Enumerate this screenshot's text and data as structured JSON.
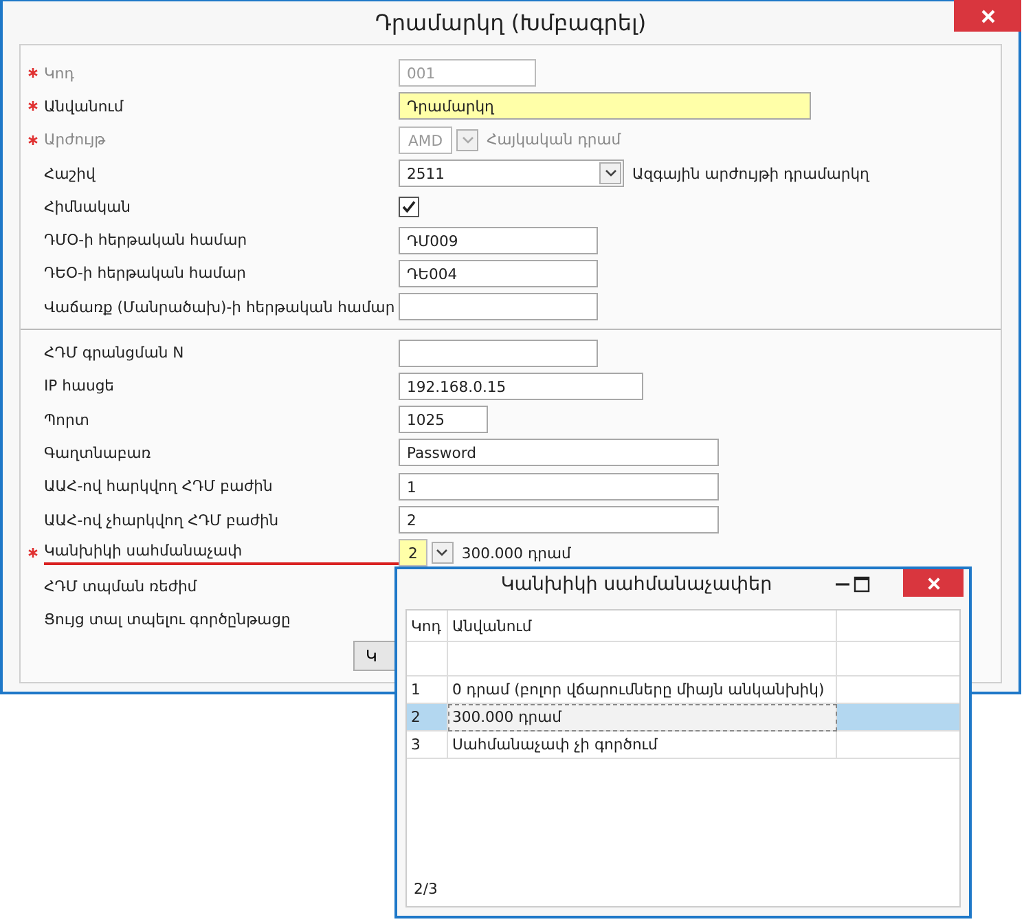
{
  "window": {
    "title": "Դրամարկղ (Խմբագրել)"
  },
  "sections": [
    {
      "fields": [
        {
          "label": "Կոդ",
          "required": true,
          "disabled": true,
          "marked": false,
          "kind": "text",
          "value": "001",
          "focused": false
        },
        {
          "label": "Անվանում",
          "required": true,
          "disabled": false,
          "marked": false,
          "kind": "text",
          "value": "Դրամարկղ",
          "focused": true
        },
        {
          "label": "Արժույթ",
          "required": true,
          "disabled": true,
          "marked": false,
          "kind": "combo",
          "value": "AMD",
          "focused": false,
          "note": "Հայկական դրամ"
        },
        {
          "label": "Հաշիվ",
          "required": false,
          "disabled": false,
          "marked": false,
          "kind": "combo",
          "value": "2511",
          "focused": false,
          "note": "Ազգային արժույթի դրամարկղ"
        },
        {
          "label": "Հիմնական",
          "required": false,
          "disabled": false,
          "marked": false,
          "kind": "checkbox",
          "checked": true
        },
        {
          "label": "ԴՄՕ-ի հերթական համար",
          "required": false,
          "disabled": false,
          "marked": false,
          "kind": "text",
          "value": "ԴՄ009",
          "focused": false
        },
        {
          "label": "ԴԵՕ-ի հերթական համար",
          "required": false,
          "disabled": false,
          "marked": false,
          "kind": "text",
          "value": "ԴԵ004",
          "focused": false
        },
        {
          "label": "Վաճառք (Մանրածախ)-ի հերթական համար",
          "required": false,
          "disabled": false,
          "marked": false,
          "kind": "text",
          "focused": false
        }
      ]
    },
    {
      "fields": [
        {
          "label": "ՀԴՄ գրանցման N",
          "required": false,
          "disabled": false,
          "marked": false,
          "kind": "text",
          "focused": false
        },
        {
          "label": "IP հասցե",
          "required": false,
          "disabled": false,
          "marked": false,
          "kind": "text",
          "value": "192.168.0.15",
          "focused": false
        },
        {
          "label": "Պորտ",
          "required": false,
          "disabled": false,
          "marked": false,
          "kind": "text",
          "value": "1025",
          "focused": false
        },
        {
          "label": "Գաղտնաբառ",
          "required": false,
          "disabled": false,
          "marked": false,
          "kind": "text",
          "value": "Password",
          "focused": false
        },
        {
          "label": "ԱԱՀ-ով հարկվող ՀԴՄ բաժին",
          "required": false,
          "disabled": false,
          "marked": false,
          "kind": "text",
          "value": "1",
          "focused": false
        },
        {
          "label": "ԱԱՀ-ով չհարկվող ՀԴՄ բաժին",
          "required": false,
          "disabled": false,
          "marked": false,
          "kind": "text",
          "value": "2",
          "focused": false
        },
        {
          "label": "Կանխիկի սահմանաչափ",
          "required": true,
          "disabled": false,
          "marked": true,
          "kind": "combo",
          "value": "2",
          "focused": true,
          "note": "300.000 դրամ"
        },
        {
          "label": "ՀԴՄ տպման ռեժիմ",
          "required": false,
          "disabled": false,
          "marked": false,
          "kind": "none"
        },
        {
          "label": "Ցույց տալ տպելու գործընթացը",
          "required": false,
          "disabled": false,
          "marked": false,
          "kind": "none"
        }
      ]
    }
  ],
  "button": "Կ",
  "popup": {
    "title": "Կանխիկի սահմանաչափեր",
    "columns": [
      "Կոդ",
      "Անվանում"
    ],
    "rows": [
      {
        "code": "1",
        "name": "0 դրամ (բոլոր վճարումները միայն անկանխիկ)",
        "selected": false
      },
      {
        "code": "2",
        "name": "300.000 դրամ",
        "selected": true
      },
      {
        "code": "3",
        "name": "Սահմանաչափ չի գործում",
        "selected": false
      }
    ],
    "footer": "2/3"
  }
}
